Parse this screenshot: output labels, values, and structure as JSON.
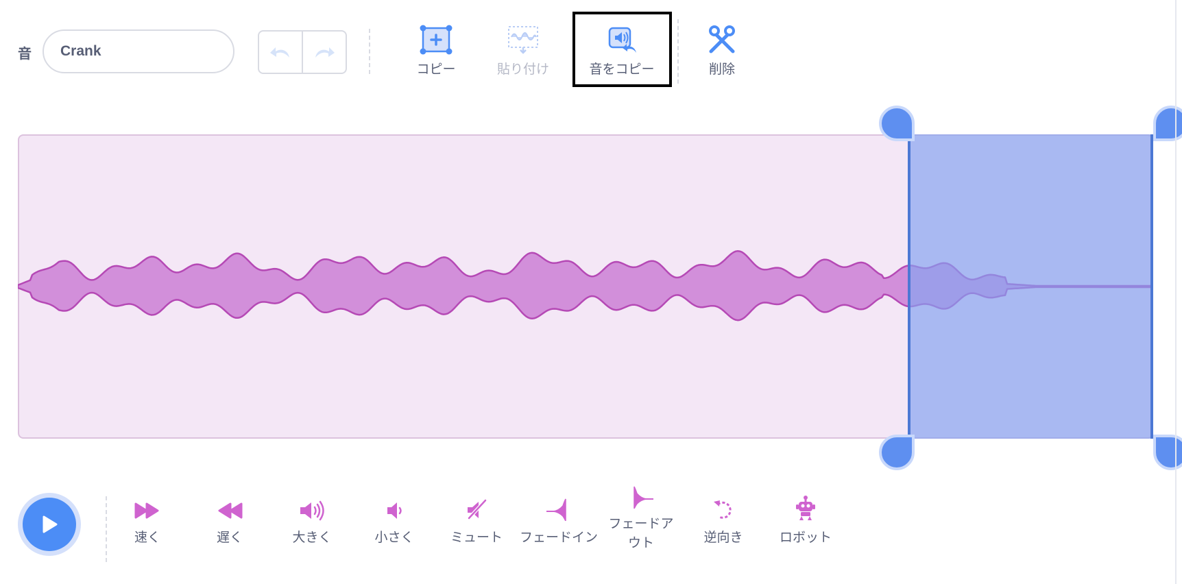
{
  "header": {
    "sound_label": "音",
    "sound_name": "Crank",
    "tools": [
      {
        "label": "コピー",
        "icon": "copy-icon",
        "enabled": true
      },
      {
        "label": "貼り付け",
        "icon": "paste-icon",
        "enabled": false
      },
      {
        "label": "音をコピー",
        "icon": "copy-to-new-icon",
        "enabled": true
      },
      {
        "label": "削除",
        "icon": "scissors-icon",
        "enabled": true
      }
    ]
  },
  "waveform": {
    "selection_start": 0.713,
    "selection_end": 1.0
  },
  "effects": [
    {
      "label": "速く",
      "icon": "fast-forward-icon"
    },
    {
      "label": "遅く",
      "icon": "rewind-icon"
    },
    {
      "label": "大きく",
      "icon": "louder-icon"
    },
    {
      "label": "小さく",
      "icon": "softer-icon"
    },
    {
      "label": "ミュート",
      "icon": "mute-icon"
    },
    {
      "label": "フェードイン",
      "icon": "fade-in-icon"
    },
    {
      "label": "フェードアウト",
      "icon": "fade-out-icon"
    },
    {
      "label": "逆向き",
      "icon": "reverse-icon"
    },
    {
      "label": "ロボット",
      "icon": "robot-icon"
    }
  ],
  "colors": {
    "accent": "#4c8df6",
    "effect_icon": "#cf63cf",
    "waveform_fill": "#d28fda",
    "waveform_stroke": "#b549b5",
    "selection": "#85a3f0"
  }
}
